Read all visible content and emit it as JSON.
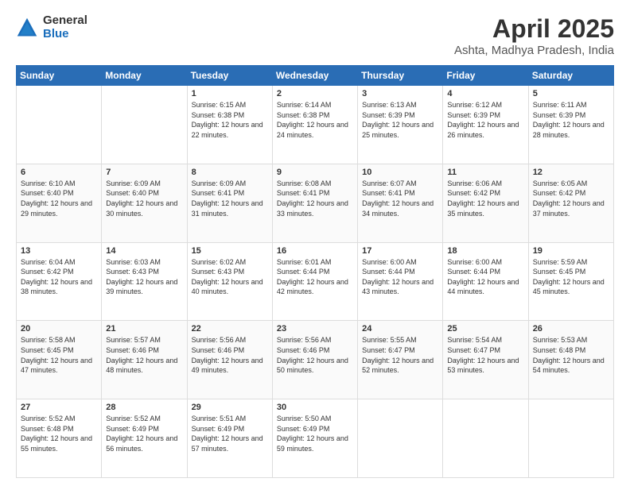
{
  "logo": {
    "general": "General",
    "blue": "Blue"
  },
  "title": "April 2025",
  "subtitle": "Ashta, Madhya Pradesh, India",
  "days_of_week": [
    "Sunday",
    "Monday",
    "Tuesday",
    "Wednesday",
    "Thursday",
    "Friday",
    "Saturday"
  ],
  "weeks": [
    [
      {
        "day": "",
        "sunrise": "",
        "sunset": "",
        "daylight": ""
      },
      {
        "day": "",
        "sunrise": "",
        "sunset": "",
        "daylight": ""
      },
      {
        "day": "1",
        "sunrise": "Sunrise: 6:15 AM",
        "sunset": "Sunset: 6:38 PM",
        "daylight": "Daylight: 12 hours and 22 minutes."
      },
      {
        "day": "2",
        "sunrise": "Sunrise: 6:14 AM",
        "sunset": "Sunset: 6:38 PM",
        "daylight": "Daylight: 12 hours and 24 minutes."
      },
      {
        "day": "3",
        "sunrise": "Sunrise: 6:13 AM",
        "sunset": "Sunset: 6:39 PM",
        "daylight": "Daylight: 12 hours and 25 minutes."
      },
      {
        "day": "4",
        "sunrise": "Sunrise: 6:12 AM",
        "sunset": "Sunset: 6:39 PM",
        "daylight": "Daylight: 12 hours and 26 minutes."
      },
      {
        "day": "5",
        "sunrise": "Sunrise: 6:11 AM",
        "sunset": "Sunset: 6:39 PM",
        "daylight": "Daylight: 12 hours and 28 minutes."
      }
    ],
    [
      {
        "day": "6",
        "sunrise": "Sunrise: 6:10 AM",
        "sunset": "Sunset: 6:40 PM",
        "daylight": "Daylight: 12 hours and 29 minutes."
      },
      {
        "day": "7",
        "sunrise": "Sunrise: 6:09 AM",
        "sunset": "Sunset: 6:40 PM",
        "daylight": "Daylight: 12 hours and 30 minutes."
      },
      {
        "day": "8",
        "sunrise": "Sunrise: 6:09 AM",
        "sunset": "Sunset: 6:41 PM",
        "daylight": "Daylight: 12 hours and 31 minutes."
      },
      {
        "day": "9",
        "sunrise": "Sunrise: 6:08 AM",
        "sunset": "Sunset: 6:41 PM",
        "daylight": "Daylight: 12 hours and 33 minutes."
      },
      {
        "day": "10",
        "sunrise": "Sunrise: 6:07 AM",
        "sunset": "Sunset: 6:41 PM",
        "daylight": "Daylight: 12 hours and 34 minutes."
      },
      {
        "day": "11",
        "sunrise": "Sunrise: 6:06 AM",
        "sunset": "Sunset: 6:42 PM",
        "daylight": "Daylight: 12 hours and 35 minutes."
      },
      {
        "day": "12",
        "sunrise": "Sunrise: 6:05 AM",
        "sunset": "Sunset: 6:42 PM",
        "daylight": "Daylight: 12 hours and 37 minutes."
      }
    ],
    [
      {
        "day": "13",
        "sunrise": "Sunrise: 6:04 AM",
        "sunset": "Sunset: 6:42 PM",
        "daylight": "Daylight: 12 hours and 38 minutes."
      },
      {
        "day": "14",
        "sunrise": "Sunrise: 6:03 AM",
        "sunset": "Sunset: 6:43 PM",
        "daylight": "Daylight: 12 hours and 39 minutes."
      },
      {
        "day": "15",
        "sunrise": "Sunrise: 6:02 AM",
        "sunset": "Sunset: 6:43 PM",
        "daylight": "Daylight: 12 hours and 40 minutes."
      },
      {
        "day": "16",
        "sunrise": "Sunrise: 6:01 AM",
        "sunset": "Sunset: 6:44 PM",
        "daylight": "Daylight: 12 hours and 42 minutes."
      },
      {
        "day": "17",
        "sunrise": "Sunrise: 6:00 AM",
        "sunset": "Sunset: 6:44 PM",
        "daylight": "Daylight: 12 hours and 43 minutes."
      },
      {
        "day": "18",
        "sunrise": "Sunrise: 6:00 AM",
        "sunset": "Sunset: 6:44 PM",
        "daylight": "Daylight: 12 hours and 44 minutes."
      },
      {
        "day": "19",
        "sunrise": "Sunrise: 5:59 AM",
        "sunset": "Sunset: 6:45 PM",
        "daylight": "Daylight: 12 hours and 45 minutes."
      }
    ],
    [
      {
        "day": "20",
        "sunrise": "Sunrise: 5:58 AM",
        "sunset": "Sunset: 6:45 PM",
        "daylight": "Daylight: 12 hours and 47 minutes."
      },
      {
        "day": "21",
        "sunrise": "Sunrise: 5:57 AM",
        "sunset": "Sunset: 6:46 PM",
        "daylight": "Daylight: 12 hours and 48 minutes."
      },
      {
        "day": "22",
        "sunrise": "Sunrise: 5:56 AM",
        "sunset": "Sunset: 6:46 PM",
        "daylight": "Daylight: 12 hours and 49 minutes."
      },
      {
        "day": "23",
        "sunrise": "Sunrise: 5:56 AM",
        "sunset": "Sunset: 6:46 PM",
        "daylight": "Daylight: 12 hours and 50 minutes."
      },
      {
        "day": "24",
        "sunrise": "Sunrise: 5:55 AM",
        "sunset": "Sunset: 6:47 PM",
        "daylight": "Daylight: 12 hours and 52 minutes."
      },
      {
        "day": "25",
        "sunrise": "Sunrise: 5:54 AM",
        "sunset": "Sunset: 6:47 PM",
        "daylight": "Daylight: 12 hours and 53 minutes."
      },
      {
        "day": "26",
        "sunrise": "Sunrise: 5:53 AM",
        "sunset": "Sunset: 6:48 PM",
        "daylight": "Daylight: 12 hours and 54 minutes."
      }
    ],
    [
      {
        "day": "27",
        "sunrise": "Sunrise: 5:52 AM",
        "sunset": "Sunset: 6:48 PM",
        "daylight": "Daylight: 12 hours and 55 minutes."
      },
      {
        "day": "28",
        "sunrise": "Sunrise: 5:52 AM",
        "sunset": "Sunset: 6:49 PM",
        "daylight": "Daylight: 12 hours and 56 minutes."
      },
      {
        "day": "29",
        "sunrise": "Sunrise: 5:51 AM",
        "sunset": "Sunset: 6:49 PM",
        "daylight": "Daylight: 12 hours and 57 minutes."
      },
      {
        "day": "30",
        "sunrise": "Sunrise: 5:50 AM",
        "sunset": "Sunset: 6:49 PM",
        "daylight": "Daylight: 12 hours and 59 minutes."
      },
      {
        "day": "",
        "sunrise": "",
        "sunset": "",
        "daylight": ""
      },
      {
        "day": "",
        "sunrise": "",
        "sunset": "",
        "daylight": ""
      },
      {
        "day": "",
        "sunrise": "",
        "sunset": "",
        "daylight": ""
      }
    ]
  ]
}
